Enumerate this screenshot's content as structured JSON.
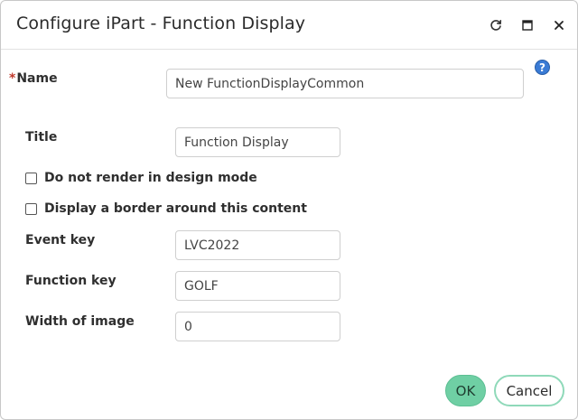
{
  "dialog": {
    "title": "Configure iPart - Function Display",
    "controls": {
      "refresh_icon": "refresh-icon",
      "maximize_icon": "maximize-icon",
      "close_icon": "close-icon"
    }
  },
  "form": {
    "name": {
      "required_mark": "*",
      "label": "Name",
      "value": "New FunctionDisplayCommon"
    },
    "help": {
      "glyph": "?",
      "icon": "help-icon"
    },
    "title": {
      "label": "Title",
      "value": "Function Display"
    },
    "no_render_design": {
      "label": "Do not render in design mode",
      "checked": false
    },
    "display_border": {
      "label": "Display a border around this content",
      "checked": false
    },
    "event_key": {
      "label": "Event key",
      "value": "LVC2022"
    },
    "function_key": {
      "label": "Function key",
      "value": "GOLF"
    },
    "width_of_image": {
      "label": "Width of image",
      "value": "0"
    }
  },
  "footer": {
    "ok_label": "OK",
    "cancel_label": "Cancel",
    "ok_color": "#6fcfa4",
    "cancel_border_color": "#8fd9b9"
  }
}
